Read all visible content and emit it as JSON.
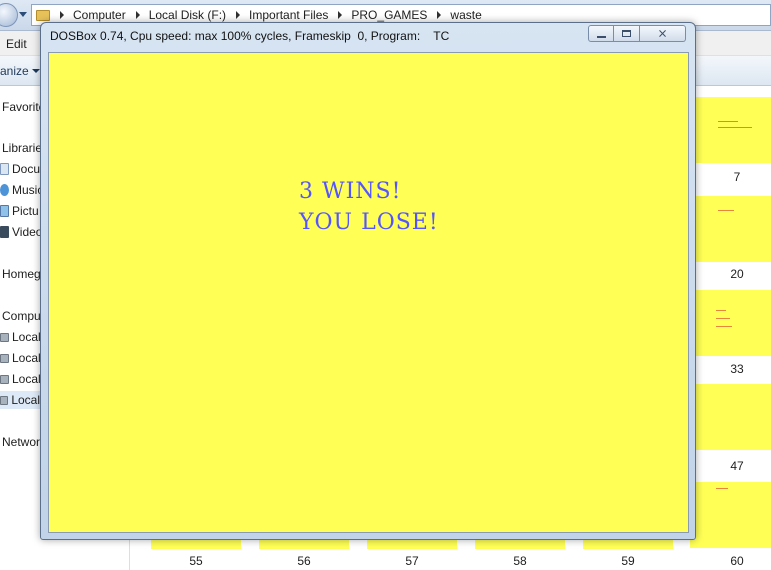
{
  "explorer": {
    "breadcrumb": [
      "Computer",
      "Local Disk (F:)",
      "Important Files",
      "PRO_GAMES",
      "waste"
    ],
    "menu": {
      "edit": "Edit"
    },
    "commandbar": {
      "organize": "anize"
    },
    "nav": {
      "favorites": "Favorite",
      "libraries": "Librarie",
      "docs": "Docu",
      "music": "Music",
      "pictures": "Pictu",
      "videos": "Video",
      "homegroup": "Homeg",
      "computer": "Compu",
      "disk1": "Local",
      "disk2": "Local",
      "disk3": "Local",
      "disk4": "Local",
      "network": "Networ"
    },
    "thumb_numbers": {
      "n7": "7",
      "n20": "20",
      "n33": "33",
      "n47": "47",
      "n55": "55",
      "n56": "56",
      "n57": "57",
      "n58": "58",
      "n59": "59",
      "n60": "60"
    }
  },
  "dosbox": {
    "title": "DOSBox 0.74, Cpu speed: max 100% cycles, Frameskip  0, Program:    TC",
    "screen_bg": "#ffff55",
    "text_color": "#5555ff",
    "line1": "3 WINS!",
    "line2": "YOU LOSE!",
    "close_label": "⨯"
  }
}
